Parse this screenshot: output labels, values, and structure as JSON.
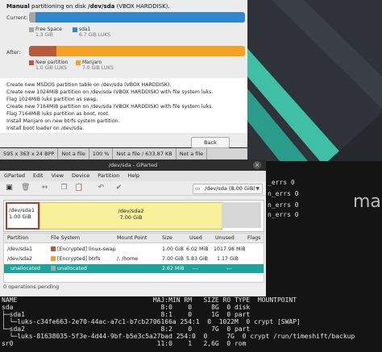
{
  "installer": {
    "title_prefix": "Manual",
    "title_mid": " partitioning on disk ",
    "title_bold": "/dev/sda",
    "title_suffix": " (VBOX HARDDISK).",
    "current_label": "Current:",
    "after_label": "After:",
    "current_legend": [
      {
        "name": "Free Space",
        "sub": "1.3 GiB",
        "color": "#a6a6a6"
      },
      {
        "name": "sda1",
        "sub": "6.7 GiB  LUKS",
        "color": "#2f86d1"
      }
    ],
    "after_legend": [
      {
        "name": "New partition",
        "sub": "1.0 GiB  LUKS",
        "color": "#b65a3a"
      },
      {
        "name": "Manjaro",
        "sub": "7.0 GiB  LUKS",
        "color": "#f4a124"
      }
    ],
    "summary_lines": [
      "Create new MSDOS partition table on /dev/sda (VBOX HARDDISK).",
      "Create new 1024MiB partition on /dev/sda (VBOX HARDDISK) with file system luks.",
      "Flag 1024MiB luks partition as swap.",
      "Create new 7164MiB partition on /dev/sda (VBOX HARDDISK) with file system luks.",
      "Flag 7164MiB luks partition as boot, root.",
      "Install Manjaro on new btrfs system partition.",
      "Install boot loader on /dev/sda."
    ],
    "back_label": "Back"
  },
  "image_viewer_status": [
    "595 x 363 x 24 BPP",
    "Not a file",
    "100 %",
    "Not a file / 633.87 KB",
    "Not a file"
  ],
  "gparted": {
    "title": "/dev/sda - GParted",
    "menu": [
      "GParted",
      "Edit",
      "View",
      "Device",
      "Partition",
      "Help"
    ],
    "device": "/dev/sda (8.00 GiB)",
    "map": {
      "sda1_name": "/dev/sda1",
      "sda1_size": "1.00 GiB",
      "sda2_name": "/dev/sda2",
      "sda2_size": "7.00 GiB"
    },
    "columns": [
      "Partition",
      "File System",
      "Mount Point",
      "Size",
      "Used",
      "Unused",
      "Flags"
    ],
    "rows": [
      {
        "partition": "/dev/sda1",
        "fs": "[Encrypted] linux-swap",
        "mount": "",
        "size": "1.00 GiB",
        "used": "6.02 MiB",
        "unused": "1017.98 MiB",
        "flags": "",
        "color": "#b65a3a",
        "sel": false
      },
      {
        "partition": "/dev/sda2",
        "fs": "[Encrypted] btrfs",
        "mount": "/, /home",
        "size": "7.00 GiB",
        "used": "5.83 GiB",
        "unused": "1.17 GiB",
        "flags": "",
        "color": "#f4a124",
        "sel": false
      },
      {
        "partition": "unallocated",
        "fs": "unallocated",
        "mount": "",
        "size": "2.62 MiB",
        "used": "---",
        "unused": "---",
        "flags": "",
        "color": "#a6a6a6",
        "sel": true
      }
    ],
    "status": "0 operations pending"
  },
  "terminal_right": [
    "_errs     0",
    "n_errs    0",
    "n_errs    0",
    "n_errs    0"
  ],
  "wall_text": "ma",
  "terminal_bottom": [
    "NAME                                   MAJ:MIN RM   SIZE RO TYPE  MOUNTPOINT",
    "sda                                      8:0    0     8G  0 disk",
    "├─sda1                                   8:1    0     1G  0 part",
    "│ └─luks-c34fe663-2e70-44ac-a7c1-b7cb2706166a 254:1  0  1022M  0 crypt [SWAP]",
    "└─sda2                                   8:2    0     7G  0 part",
    "  └─luks-81638035-5f3e-4d44-9bf-b5e3c5a27bad 254:0  0     7G  0 crypt /run/timeshift/backup",
    "sr0                                     11:0    1   2,6G  0 rom"
  ]
}
